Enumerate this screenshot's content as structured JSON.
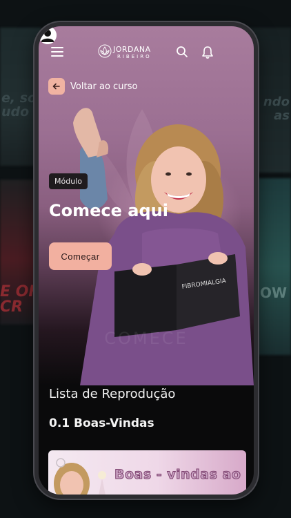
{
  "background_texts": {
    "left_top": "e, soi\nudo C",
    "left_mid": "E OF\nCR",
    "right_top": "ndo\nas",
    "right_mid": "OW"
  },
  "header": {
    "logo_name": "JORDANA",
    "logo_sub": "RIBEIRO",
    "icons": [
      "menu-icon",
      "search-icon",
      "bell-icon",
      "user-avatar-icon"
    ]
  },
  "back": {
    "label": "Voltar ao curso",
    "icon": "arrow-left-icon"
  },
  "module": {
    "badge": "Módulo",
    "title": "Comece aqui",
    "start_label": "Começar",
    "watermark": "COMECE"
  },
  "playlist": {
    "heading": "Lista de Reprodução",
    "lesson_title": "0.1 Boas-Vindas",
    "card_text": "Boas - vindas ao"
  },
  "colors": {
    "accent": "#f2b0a0",
    "hero_top": "#a87c9d",
    "screen_bg": "#0a0a0b"
  }
}
